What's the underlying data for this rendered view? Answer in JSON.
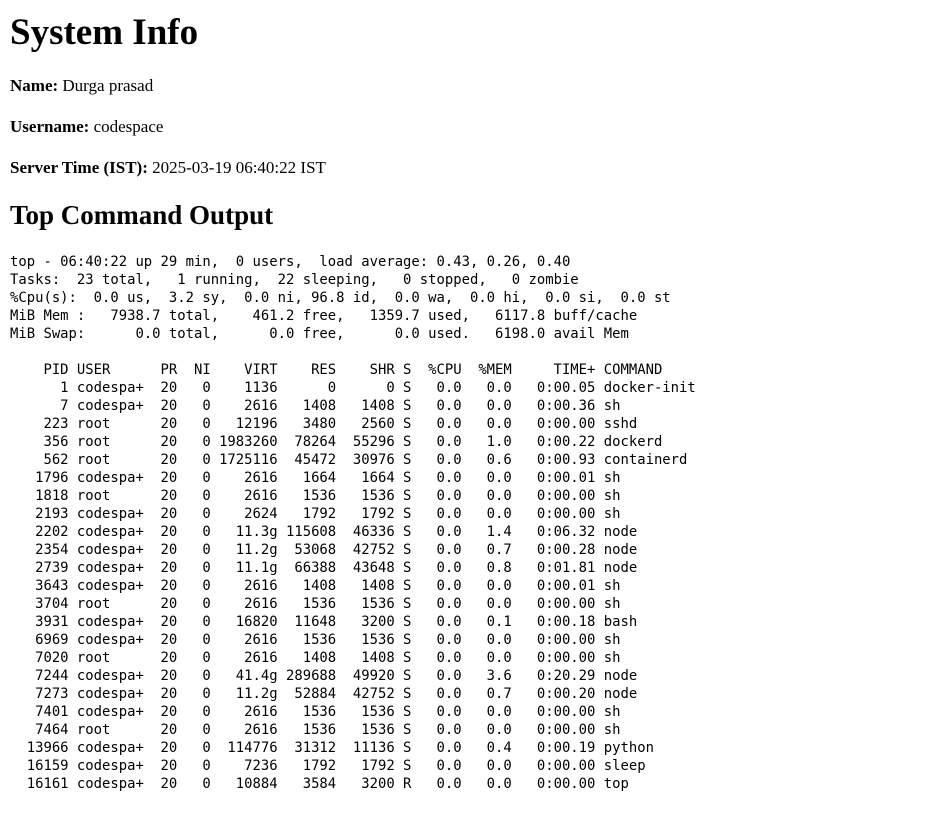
{
  "page": {
    "title": "System Info",
    "name_label": "Name:",
    "name_value": "Durga prasad",
    "username_label": "Username:",
    "username_value": "codespace",
    "server_time_label": "Server Time (IST):",
    "server_time_value": "2025-03-19 06:40:22 IST",
    "top_heading": "Top Command Output"
  },
  "top_output": {
    "summary": [
      "top - 06:40:22 up 29 min,  0 users,  load average: 0.43, 0.26, 0.40",
      "Tasks:  23 total,   1 running,  22 sleeping,   0 stopped,   0 zombie",
      "%Cpu(s):  0.0 us,  3.2 sy,  0.0 ni, 96.8 id,  0.0 wa,  0.0 hi,  0.0 si,  0.0 st",
      "MiB Mem :   7938.7 total,    461.2 free,   1359.7 used,   6117.8 buff/cache",
      "MiB Swap:      0.0 total,      0.0 free,      0.0 used.   6198.0 avail Mem"
    ],
    "header": "    PID USER      PR  NI    VIRT    RES    SHR S  %CPU  %MEM     TIME+ COMMAND",
    "rows": [
      "      1 codespa+  20   0    1136      0      0 S   0.0   0.0   0:00.05 docker-init",
      "      7 codespa+  20   0    2616   1408   1408 S   0.0   0.0   0:00.36 sh",
      "    223 root      20   0   12196   3480   2560 S   0.0   0.0   0:00.00 sshd",
      "    356 root      20   0 1983260  78264  55296 S   0.0   1.0   0:00.22 dockerd",
      "    562 root      20   0 1725116  45472  30976 S   0.0   0.6   0:00.93 containerd",
      "   1796 codespa+  20   0    2616   1664   1664 S   0.0   0.0   0:00.01 sh",
      "   1818 root      20   0    2616   1536   1536 S   0.0   0.0   0:00.00 sh",
      "   2193 codespa+  20   0    2624   1792   1792 S   0.0   0.0   0:00.00 sh",
      "   2202 codespa+  20   0   11.3g 115608  46336 S   0.0   1.4   0:06.32 node",
      "   2354 codespa+  20   0   11.2g  53068  42752 S   0.0   0.7   0:00.28 node",
      "   2739 codespa+  20   0   11.1g  66388  43648 S   0.0   0.8   0:01.81 node",
      "   3643 codespa+  20   0    2616   1408   1408 S   0.0   0.0   0:00.01 sh",
      "   3704 root      20   0    2616   1536   1536 S   0.0   0.0   0:00.00 sh",
      "   3931 codespa+  20   0   16820  11648   3200 S   0.0   0.1   0:00.18 bash",
      "   6969 codespa+  20   0    2616   1536   1536 S   0.0   0.0   0:00.00 sh",
      "   7020 root      20   0    2616   1408   1408 S   0.0   0.0   0:00.00 sh",
      "   7244 codespa+  20   0   41.4g 289688  49920 S   0.0   3.6   0:20.29 node",
      "   7273 codespa+  20   0   11.2g  52884  42752 S   0.0   0.7   0:00.20 node",
      "   7401 codespa+  20   0    2616   1536   1536 S   0.0   0.0   0:00.00 sh",
      "   7464 root      20   0    2616   1536   1536 S   0.0   0.0   0:00.00 sh",
      "  13966 codespa+  20   0  114776  31312  11136 S   0.0   0.4   0:00.19 python",
      "  16159 codespa+  20   0    7236   1792   1792 S   0.0   0.0   0:00.00 sleep",
      "  16161 codespa+  20   0   10884   3584   3200 R   0.0   0.0   0:00.00 top"
    ]
  }
}
